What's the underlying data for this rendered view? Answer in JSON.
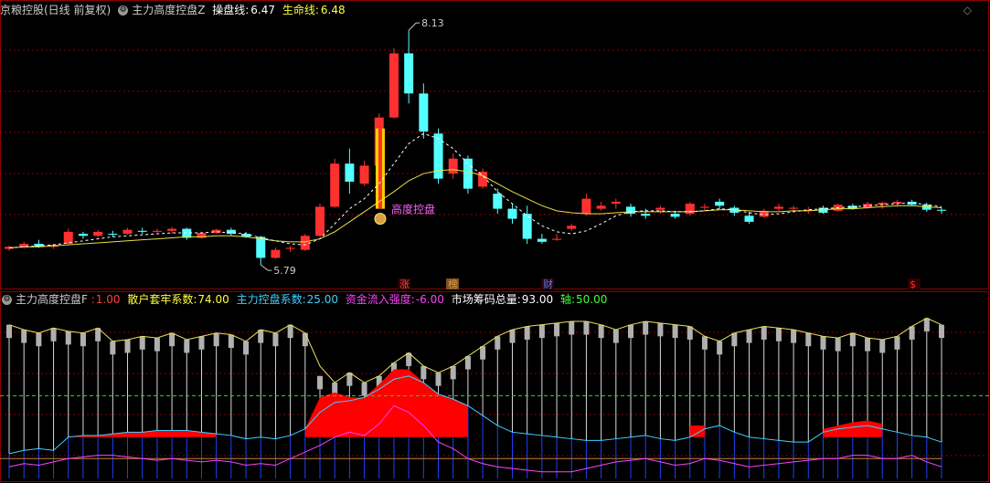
{
  "main_header": {
    "stock_name": "京粮控股(日线 前复权)",
    "indicator_name": "主力高度控盘Z",
    "line1_label": "操盘线:",
    "line1_value": "6.47",
    "line2_label": "生命线:",
    "line2_value": "6.48"
  },
  "sub_header": {
    "indicator_name": "主力高度控盘F",
    "items": [
      {
        "label": ":",
        "value": "1.00",
        "color": "#ff4040"
      },
      {
        "label": "散户套牢系数:",
        "value": "74.00",
        "color": "#ffff40"
      },
      {
        "label": "主力控盘系数:",
        "value": "25.00",
        "color": "#40d0ff"
      },
      {
        "label": "资金流入强度:",
        "value": "-6.00",
        "color": "#ff40ff"
      },
      {
        "label": "市场筹码总量:",
        "value": "93.00",
        "color": "#ffffff"
      },
      {
        "label": "轴:",
        "value": "50.00",
        "color": "#40ff40"
      }
    ]
  },
  "chart_data": {
    "type": "candlestick",
    "y_min_label": "5.79",
    "y_max_label": "8.13",
    "signal_label": "高度控盘",
    "markers": [
      "涨",
      "榜",
      "财",
      "$"
    ],
    "candles": [
      [
        5.95,
        5.98,
        5.93,
        5.97
      ],
      [
        5.97,
        6.02,
        5.95,
        6.0
      ],
      [
        6.0,
        6.04,
        5.96,
        5.97
      ],
      [
        5.97,
        6.0,
        5.95,
        5.99
      ],
      [
        6.0,
        6.15,
        5.99,
        6.12
      ],
      [
        6.1,
        6.12,
        6.05,
        6.08
      ],
      [
        6.08,
        6.14,
        6.06,
        6.12
      ],
      [
        6.1,
        6.13,
        6.07,
        6.09
      ],
      [
        6.1,
        6.16,
        6.09,
        6.14
      ],
      [
        6.13,
        6.16,
        6.1,
        6.12
      ],
      [
        6.12,
        6.15,
        6.11,
        6.13
      ],
      [
        6.13,
        6.17,
        6.1,
        6.15
      ],
      [
        6.15,
        6.16,
        6.04,
        6.06
      ],
      [
        6.06,
        6.12,
        6.05,
        6.11
      ],
      [
        6.11,
        6.15,
        6.1,
        6.14
      ],
      [
        6.14,
        6.16,
        6.08,
        6.1
      ],
      [
        6.1,
        6.12,
        6.06,
        6.07
      ],
      [
        6.07,
        6.08,
        5.79,
        5.86
      ],
      [
        5.86,
        5.96,
        5.85,
        5.94
      ],
      [
        5.95,
        5.98,
        5.92,
        5.96
      ],
      [
        5.94,
        6.1,
        5.93,
        6.08
      ],
      [
        6.08,
        6.4,
        6.07,
        6.37
      ],
      [
        6.37,
        6.85,
        6.36,
        6.8
      ],
      [
        6.8,
        6.95,
        6.5,
        6.62
      ],
      [
        6.6,
        6.83,
        6.58,
        6.78
      ],
      [
        6.78,
        7.3,
        6.77,
        7.26
      ],
      [
        7.26,
        7.95,
        7.25,
        7.9
      ],
      [
        7.9,
        8.13,
        7.4,
        7.5
      ],
      [
        7.5,
        7.6,
        7.05,
        7.12
      ],
      [
        7.1,
        7.15,
        6.6,
        6.65
      ],
      [
        6.7,
        6.9,
        6.65,
        6.85
      ],
      [
        6.85,
        6.88,
        6.5,
        6.55
      ],
      [
        6.57,
        6.75,
        6.55,
        6.72
      ],
      [
        6.5,
        6.55,
        6.3,
        6.35
      ],
      [
        6.35,
        6.4,
        6.2,
        6.25
      ],
      [
        6.3,
        6.38,
        6.0,
        6.05
      ],
      [
        6.05,
        6.1,
        6.0,
        6.02
      ],
      [
        6.04,
        6.1,
        6.03,
        6.05
      ],
      [
        6.15,
        6.2,
        6.13,
        6.18
      ],
      [
        6.3,
        6.5,
        6.28,
        6.45
      ],
      [
        6.35,
        6.42,
        6.33,
        6.38
      ],
      [
        6.4,
        6.45,
        6.35,
        6.42
      ],
      [
        6.37,
        6.4,
        6.27,
        6.3
      ],
      [
        6.3,
        6.35,
        6.25,
        6.28
      ],
      [
        6.34,
        6.38,
        6.3,
        6.36
      ],
      [
        6.3,
        6.33,
        6.25,
        6.27
      ],
      [
        6.3,
        6.42,
        6.28,
        6.4
      ],
      [
        6.36,
        6.4,
        6.33,
        6.37
      ],
      [
        6.42,
        6.45,
        6.35,
        6.38
      ],
      [
        6.36,
        6.38,
        6.28,
        6.31
      ],
      [
        6.28,
        6.32,
        6.2,
        6.22
      ],
      [
        6.27,
        6.35,
        6.26,
        6.33
      ],
      [
        6.35,
        6.4,
        6.33,
        6.37
      ],
      [
        6.35,
        6.38,
        6.33,
        6.36
      ],
      [
        6.33,
        6.37,
        6.3,
        6.34
      ],
      [
        6.36,
        6.38,
        6.3,
        6.31
      ],
      [
        6.33,
        6.4,
        6.32,
        6.39
      ],
      [
        6.38,
        6.4,
        6.34,
        6.35
      ],
      [
        6.36,
        6.42,
        6.35,
        6.4
      ],
      [
        6.39,
        6.42,
        6.35,
        6.41
      ],
      [
        6.4,
        6.44,
        6.37,
        6.42
      ],
      [
        6.42,
        6.44,
        6.38,
        6.39
      ],
      [
        6.39,
        6.41,
        6.32,
        6.34
      ],
      [
        6.34,
        6.36,
        6.3,
        6.33
      ]
    ],
    "ma_white": [
      5.96,
      5.97,
      5.98,
      5.99,
      6.01,
      6.03,
      6.05,
      6.07,
      6.08,
      6.09,
      6.1,
      6.11,
      6.11,
      6.11,
      6.12,
      6.11,
      6.1,
      6.06,
      6.03,
      6.0,
      5.99,
      6.05,
      6.2,
      6.35,
      6.45,
      6.6,
      6.8,
      7.0,
      7.1,
      7.05,
      6.95,
      6.8,
      6.68,
      6.52,
      6.4,
      6.28,
      6.18,
      6.12,
      6.1,
      6.13,
      6.2,
      6.28,
      6.32,
      6.33,
      6.33,
      6.32,
      6.32,
      6.33,
      6.35,
      6.34,
      6.31,
      6.29,
      6.3,
      6.32,
      6.34,
      6.35,
      6.36,
      6.37,
      6.38,
      6.39,
      6.4,
      6.41,
      6.39,
      6.37
    ],
    "ma_yellow": [
      5.96,
      5.97,
      5.97,
      5.98,
      5.99,
      6.0,
      6.01,
      6.02,
      6.03,
      6.04,
      6.05,
      6.06,
      6.07,
      6.07,
      6.08,
      6.08,
      6.07,
      6.05,
      6.03,
      6.02,
      6.02,
      6.05,
      6.12,
      6.22,
      6.32,
      6.42,
      6.52,
      6.63,
      6.7,
      6.73,
      6.74,
      6.72,
      6.68,
      6.6,
      6.52,
      6.45,
      6.38,
      6.33,
      6.31,
      6.3,
      6.3,
      6.31,
      6.32,
      6.32,
      6.32,
      6.32,
      6.32,
      6.33,
      6.34,
      6.34,
      6.33,
      6.32,
      6.32,
      6.33,
      6.33,
      6.34,
      6.35,
      6.35,
      6.36,
      6.37,
      6.38,
      6.38,
      6.37,
      6.36
    ]
  },
  "sub_chart": {
    "white_top": [
      93,
      90,
      88,
      91,
      89,
      88,
      91,
      83,
      84,
      86,
      85,
      88,
      84,
      86,
      88,
      87,
      83,
      90,
      88,
      93,
      88,
      62,
      58,
      64,
      58,
      62,
      70,
      76,
      68,
      64,
      68,
      74,
      80,
      86,
      90,
      92,
      93,
      94,
      95,
      95,
      93,
      90,
      93,
      95,
      94,
      93,
      92,
      86,
      83,
      88,
      90,
      92,
      91,
      90,
      88,
      86,
      85,
      88,
      85,
      84,
      86,
      92,
      97,
      93
    ],
    "yellow_env": [
      93,
      90,
      88,
      91,
      89,
      88,
      91,
      83,
      84,
      86,
      85,
      88,
      84,
      86,
      88,
      87,
      83,
      90,
      88,
      93,
      88,
      68,
      58,
      64,
      58,
      62,
      70,
      76,
      68,
      64,
      68,
      74,
      80,
      86,
      90,
      92,
      93,
      94,
      95,
      95,
      93,
      90,
      93,
      95,
      94,
      93,
      92,
      86,
      83,
      88,
      90,
      92,
      91,
      90,
      88,
      86,
      85,
      88,
      85,
      84,
      86,
      92,
      97,
      93
    ],
    "red_fill": [
      0,
      0,
      0,
      0,
      25,
      26,
      26,
      27,
      28,
      28,
      29,
      29,
      29,
      28,
      27,
      0,
      0,
      0,
      0,
      0,
      30,
      49,
      52,
      49,
      49,
      57,
      66,
      66,
      58,
      51,
      48,
      44,
      0,
      0,
      0,
      0,
      0,
      0,
      0,
      0,
      0,
      0,
      0,
      0,
      0,
      0,
      32,
      32,
      0,
      0,
      0,
      0,
      0,
      0,
      0,
      30,
      32,
      34,
      35,
      33,
      0,
      0,
      0,
      0
    ],
    "cyan_line": [
      15,
      17,
      18,
      17,
      25,
      26,
      26,
      27,
      28,
      28,
      29,
      29,
      29,
      28,
      27,
      26,
      24,
      25,
      24,
      26,
      30,
      40,
      46,
      47,
      49,
      54,
      60,
      62,
      58,
      51,
      48,
      44,
      38,
      32,
      28,
      27,
      26,
      25,
      24,
      23,
      23,
      24,
      25,
      26,
      24,
      23,
      25,
      30,
      32,
      28,
      25,
      24,
      23,
      22,
      22,
      28,
      30,
      31,
      32,
      30,
      28,
      26,
      25,
      22
    ],
    "magenta_line": [
      7,
      9,
      8,
      10,
      12,
      13,
      14,
      14,
      13,
      12,
      11,
      12,
      11,
      10,
      11,
      10,
      8,
      9,
      8,
      12,
      16,
      20,
      25,
      28,
      26,
      33,
      44,
      40,
      32,
      22,
      18,
      12,
      9,
      7,
      6,
      5,
      4,
      4,
      4,
      6,
      8,
      10,
      11,
      12,
      10,
      8,
      9,
      12,
      11,
      9,
      7,
      8,
      9,
      10,
      11,
      12,
      12,
      14,
      14,
      12,
      12,
      14,
      10,
      7
    ],
    "brown_line": 12,
    "green_axis": 50
  },
  "colors": {
    "up": "#ff3030",
    "down": "#54ffff",
    "grid": "#8b0000"
  }
}
